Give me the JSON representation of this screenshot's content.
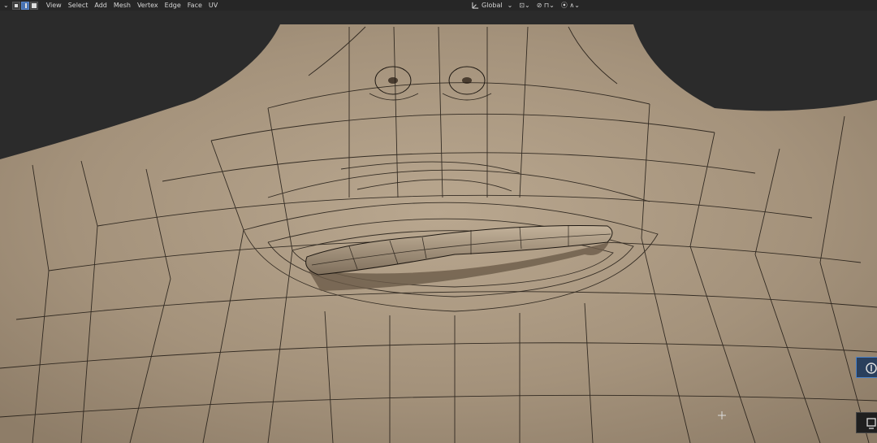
{
  "header": {
    "menu": [
      "View",
      "Select",
      "Add",
      "Mesh",
      "Vertex",
      "Edge",
      "Face",
      "UV"
    ],
    "transform_orientation": "Global"
  },
  "icons": {
    "select_modes": [
      "vertex-select-icon",
      "edge-select-icon",
      "face-select-icon"
    ],
    "pivot": "pivot-point-icon",
    "snap": "snap-icon",
    "proportional": "proportional-edit-icon",
    "tools": [
      "annotate-tool-icon",
      "select-box-tool-icon"
    ],
    "cursor": "3d-cursor-icon"
  },
  "colors": {
    "header_bg": "#262626",
    "viewport_bg": "#2b2b2b",
    "mesh": "#a8967f",
    "wire": "#1e1812",
    "accent": "#4772b3"
  }
}
